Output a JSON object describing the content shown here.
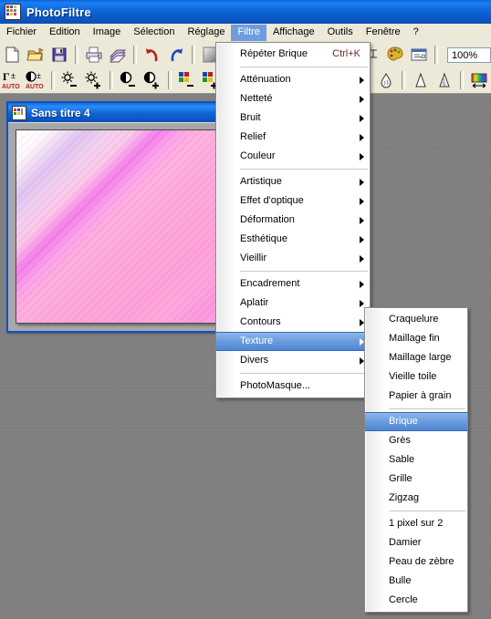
{
  "window": {
    "app_title": "PhotoFiltre",
    "app_icon": "photofiltre-icon"
  },
  "menubar": {
    "items": [
      {
        "label": "Fichier",
        "active": false
      },
      {
        "label": "Edition",
        "active": false
      },
      {
        "label": "Image",
        "active": false
      },
      {
        "label": "Sélection",
        "active": false
      },
      {
        "label": "Réglage",
        "active": false
      },
      {
        "label": "Filtre",
        "active": true
      },
      {
        "label": "Affichage",
        "active": false
      },
      {
        "label": "Outils",
        "active": false
      },
      {
        "label": "Fenêtre",
        "active": false
      },
      {
        "label": "?",
        "active": false
      }
    ]
  },
  "toolbar": {
    "row1_icons": [
      "new-document-icon",
      "open-folder-icon",
      "save-disk-icon",
      "print-icon",
      "print-preview-icon",
      "undo-icon",
      "redo-icon",
      "transparency-icon"
    ],
    "row2_icons": [
      "auto-gamma-icon",
      "auto-contrast-icon",
      "brightness-decrease-icon",
      "brightness-increase-icon",
      "contrast-decrease-icon",
      "contrast-increase-icon",
      "saturation-decrease-icon",
      "saturation-increase-icon"
    ],
    "right_icons": [
      "layers-icon",
      "palette-icon",
      "dialog-icon"
    ],
    "right_icons_row2": [
      "blur-drop-icon",
      "sharpen-cone-icon",
      "sharpen-more-icon",
      "gradient-icon"
    ],
    "zoom_value": "100%"
  },
  "document": {
    "title": "Sans titre 4",
    "icon": "image-document-icon"
  },
  "menu_filtre": {
    "items": [
      {
        "label": "Répéter Brique",
        "accel": "Ctrl+K",
        "arrow": false,
        "selected": false
      },
      {
        "separator": true
      },
      {
        "label": "Atténuation",
        "arrow": true,
        "selected": false
      },
      {
        "label": "Netteté",
        "arrow": true,
        "selected": false
      },
      {
        "label": "Bruit",
        "arrow": true,
        "selected": false
      },
      {
        "label": "Relief",
        "arrow": true,
        "selected": false
      },
      {
        "label": "Couleur",
        "arrow": true,
        "selected": false
      },
      {
        "separator": true
      },
      {
        "label": "Artistique",
        "arrow": true,
        "selected": false
      },
      {
        "label": "Effet d'optique",
        "arrow": true,
        "selected": false
      },
      {
        "label": "Déformation",
        "arrow": true,
        "selected": false
      },
      {
        "label": "Esthétique",
        "arrow": true,
        "selected": false
      },
      {
        "label": "Vieillir",
        "arrow": true,
        "selected": false
      },
      {
        "separator": true
      },
      {
        "label": "Encadrement",
        "arrow": true,
        "selected": false
      },
      {
        "label": "Aplatir",
        "arrow": true,
        "selected": false
      },
      {
        "label": "Contours",
        "arrow": true,
        "selected": false
      },
      {
        "label": "Texture",
        "arrow": true,
        "selected": true
      },
      {
        "label": "Divers",
        "arrow": true,
        "selected": false
      },
      {
        "separator": true
      },
      {
        "label": "PhotoMasque...",
        "arrow": false,
        "selected": false
      }
    ]
  },
  "menu_texture": {
    "items": [
      {
        "label": "Craquelure",
        "selected": false
      },
      {
        "label": "Maillage fin",
        "selected": false
      },
      {
        "label": "Maillage large",
        "selected": false
      },
      {
        "label": "Vieille toile",
        "selected": false
      },
      {
        "label": "Papier à grain",
        "selected": false
      },
      {
        "separator": true
      },
      {
        "label": "Brique",
        "selected": true
      },
      {
        "label": "Grès",
        "selected": false
      },
      {
        "label": "Sable",
        "selected": false
      },
      {
        "label": "Grille",
        "selected": false
      },
      {
        "label": "Zigzag",
        "selected": false
      },
      {
        "separator": true
      },
      {
        "label": "1 pixel sur 2",
        "selected": false
      },
      {
        "label": "Damier",
        "selected": false
      },
      {
        "label": "Peau de zèbre",
        "selected": false
      },
      {
        "label": "Bulle",
        "selected": false
      },
      {
        "label": "Cercle",
        "selected": false
      }
    ]
  },
  "colors": {
    "titlebar_blue": "#0e63d8",
    "menu_highlight": "#6d9ede",
    "menubar_bg": "#ece9d8",
    "desktop_gray": "#808080",
    "accel_text": "#6b2b2b"
  }
}
